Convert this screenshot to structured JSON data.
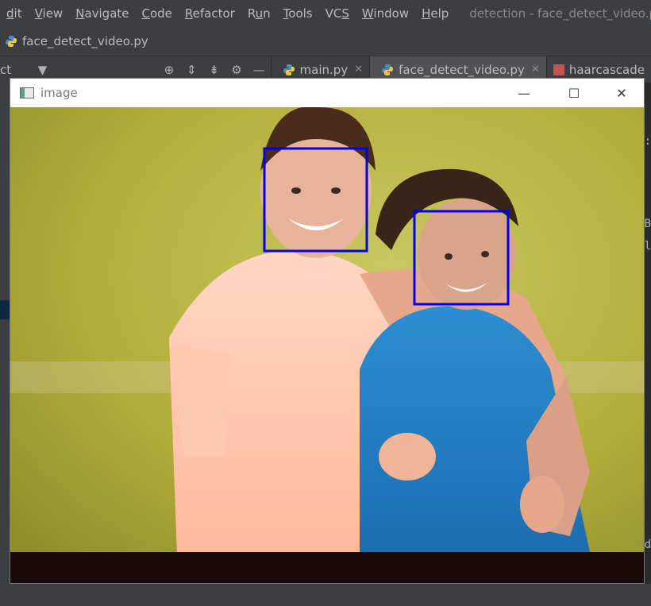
{
  "menubar": {
    "items": [
      "dit",
      "View",
      "Navigate",
      "Code",
      "Refactor",
      "Run",
      "Tools",
      "VCS",
      "Window",
      "Help"
    ],
    "underline_index": [
      0,
      0,
      0,
      0,
      0,
      1,
      0,
      2,
      0,
      0
    ],
    "title": "detection - face_detect_video.py"
  },
  "navbar": {
    "file": "face_detect_video.py"
  },
  "toolstrip": {
    "project_label": "ct",
    "tabs": [
      {
        "label": "main.py",
        "active": false
      },
      {
        "label": "face_detect_video.py",
        "active": true
      },
      {
        "label": "haarcascade",
        "active": false
      }
    ]
  },
  "editor_glyphs": {
    "g1": ":",
    "g2": "B",
    "g3": "l",
    "g4": "d"
  },
  "cv_window": {
    "title": "image",
    "detected_faces": 2,
    "box_color": "#0000e6"
  }
}
